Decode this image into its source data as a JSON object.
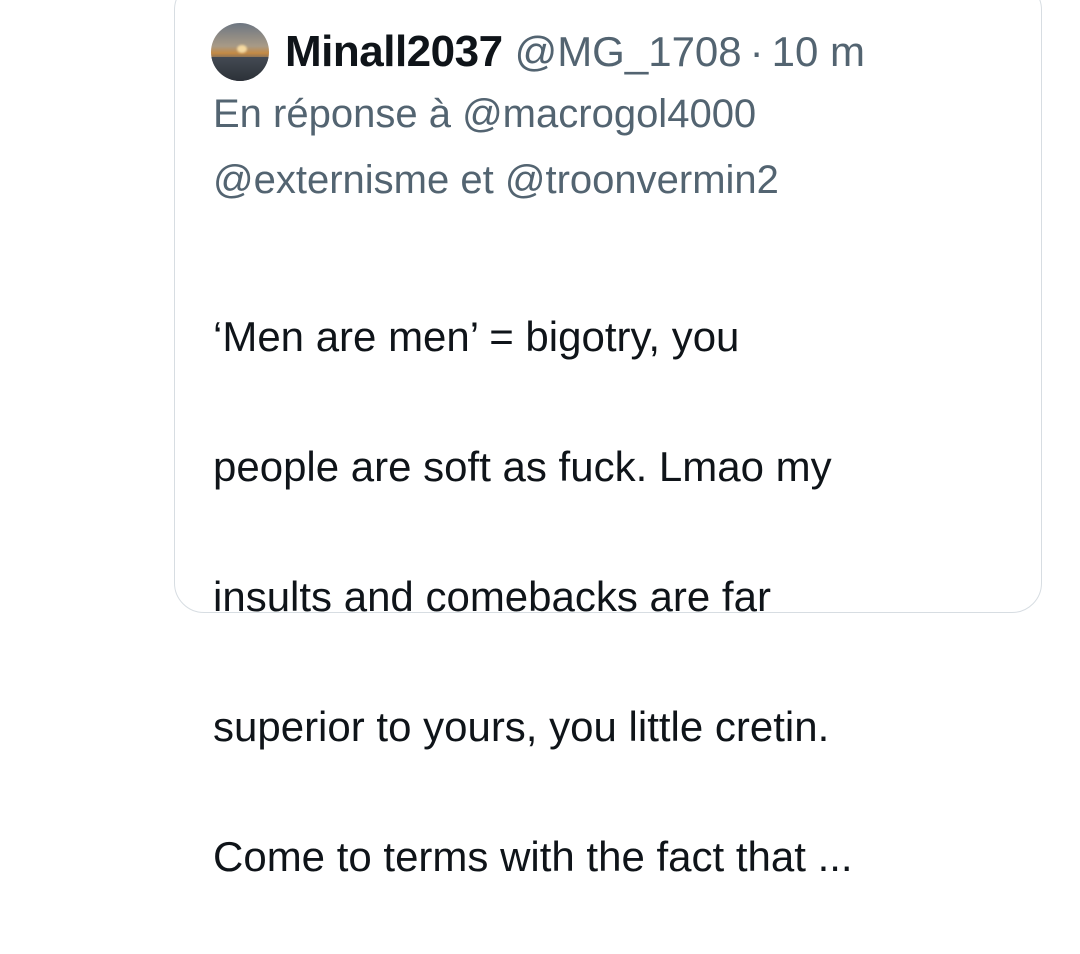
{
  "tweet": {
    "author": {
      "display_name": "Minall2037",
      "handle": "@MG_1708",
      "separator": "·",
      "time_ago": "10 m",
      "avatar_icon": "sunset-sea-avatar"
    },
    "reply_context": {
      "prefix": "En réponse à",
      "mention_1": "@macrogol4000",
      "mention_2": "@externisme",
      "conjunction": "et",
      "mention_3": "@troonvermin2"
    },
    "text_lines": [
      "‘Men are men’ = bigotry, you",
      "people are soft as fuck. Lmao my",
      "insults and comebacks are far",
      "superior to yours, you little cretin.",
      "Come to terms with the fact that ..."
    ]
  },
  "colors": {
    "primary_text": "#0f1419",
    "secondary_text": "#536471",
    "card_border": "#d7dde2"
  }
}
